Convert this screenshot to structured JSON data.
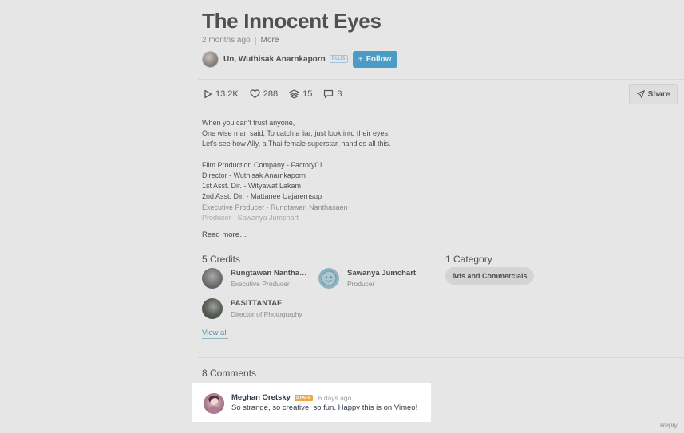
{
  "video": {
    "title": "The Innocent Eyes",
    "posted": "2 months ago",
    "more_label": "More"
  },
  "author": {
    "name": "Un, Wuthisak Anarnkaporn",
    "badge": "PLUS",
    "follow_icon": "+",
    "follow_label": "Follow"
  },
  "stats": {
    "plays": "13.2K",
    "likes": "288",
    "collections": "15",
    "comments": "8"
  },
  "share_label": "Share",
  "description": {
    "lines": [
      "When you can't trust anyone,",
      "One wise man said, To catch a liar, just look into their eyes.",
      "Let's see how Ally, a Thai female superstar, handies all this.",
      "",
      "Film Production Company - Factory01",
      "Director - Wuthisak Anarnkaporn",
      "1st Asst. Dir. - Wityawat Lakam",
      "2nd Asst. Dir. - Mattanee Uajarernsup",
      "Executive Producer - Rungtawan Nanthasaen",
      "Producer - Sawanya Jumchart"
    ],
    "read_more": "Read more…"
  },
  "credits": {
    "title": "5 Credits",
    "items": [
      {
        "name": "Rungtawan Nantha…",
        "role": "Executive Producer"
      },
      {
        "name": "Sawanya Jumchart",
        "role": "Producer"
      },
      {
        "name": "PASITTANTAE",
        "role": "Director of Photography"
      }
    ],
    "view_all": "View all"
  },
  "categories": {
    "title": "1 Category",
    "items": [
      "Ads and Commercials"
    ]
  },
  "comments": {
    "title": "8 Comments",
    "first": {
      "author": "Meghan Oretsky",
      "badge": "STAFF",
      "time": "6 days ago",
      "text": "So strange, so creative, so fun. Happy this is on Vimeo!"
    },
    "reply_label": "Reply"
  },
  "colors": {
    "accent": "#4a9cc5",
    "staff_badge": "#f2a64b",
    "page_background": "#e6e6e6"
  }
}
